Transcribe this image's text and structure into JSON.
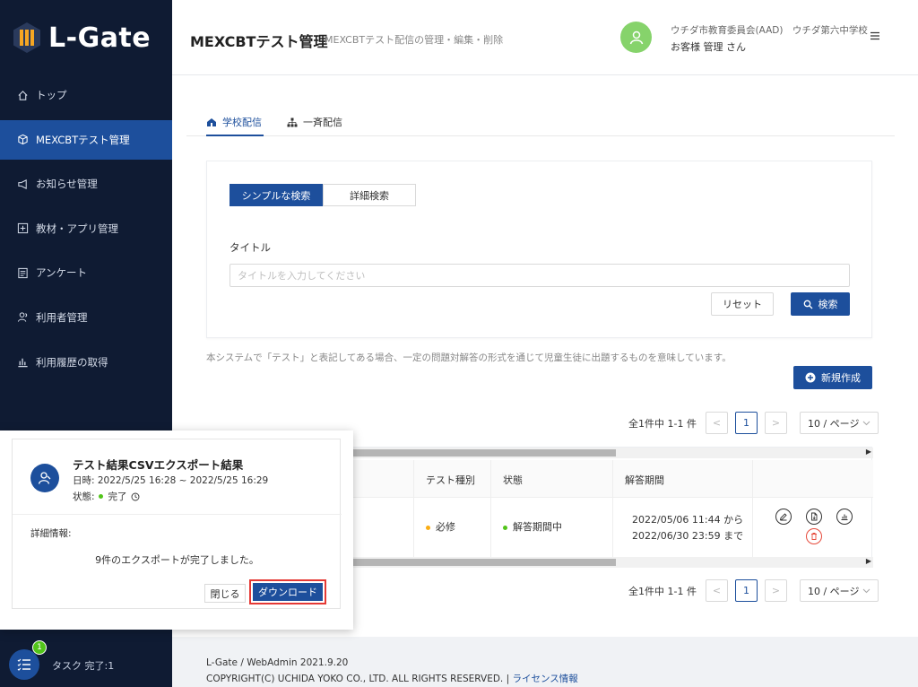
{
  "app": {
    "logo_text": "L-Gate"
  },
  "sidebar": {
    "items": [
      {
        "label": "トップ",
        "icon": "home-icon"
      },
      {
        "label": "MEXCBTテスト管理",
        "icon": "cube-icon",
        "active": true
      },
      {
        "label": "お知らせ管理",
        "icon": "megaphone-icon"
      },
      {
        "label": "教材・アプリ管理",
        "icon": "plus-square-icon"
      },
      {
        "label": "アンケート",
        "icon": "form-icon"
      },
      {
        "label": "利用者管理",
        "icon": "users-icon"
      },
      {
        "label": "利用履歴の取得",
        "icon": "bar-chart-icon"
      }
    ],
    "task": {
      "label": "タスク 完了:1",
      "badge": "1"
    }
  },
  "header": {
    "title": "MEXCBTテスト管理",
    "subtitle": "MEXCBTテスト配信の管理・編集・削除",
    "org": "ウチダ市教育委員会(AAD)　ウチダ第六中学校",
    "user": "お客様 管理 さん"
  },
  "tabs": [
    {
      "label": "学校配信",
      "icon": "school-icon",
      "active": true
    },
    {
      "label": "一斉配信",
      "icon": "sitemap-icon"
    }
  ],
  "search": {
    "mode_simple": "シンプルな検索",
    "mode_detail": "詳細検索",
    "title_label": "タイトル",
    "title_placeholder": "タイトルを入力してください",
    "reset_label": "リセット",
    "search_label": "検索"
  },
  "notice": "本システムで「テスト」と表記してある場合、一定の問題対解答の形式を通じて児童生徒に出題するものを意味しています。",
  "new_button": "新規作成",
  "pagination": {
    "total": "全1件中 1-1 件",
    "prev": "<",
    "current": "1",
    "next": ">",
    "page_size": "10 / ページ"
  },
  "table": {
    "headers": [
      "テスト種別",
      "状態",
      "解答期間"
    ],
    "rows": [
      {
        "type": "必修",
        "status": "解答期間中",
        "period_start": "2022/05/06 11:44 から",
        "period_end": "2022/06/30 23:59 まで"
      }
    ]
  },
  "popup": {
    "title": "テスト結果CSVエクスポート結果",
    "date": "日時: 2022/5/25 16:28 ~ 2022/5/25 16:29",
    "status_label": "状態:",
    "status_value": "完了",
    "detail_label": "詳細情報:",
    "detail_message": "9件のエクスポートが完了しました。",
    "close_label": "閉じる",
    "download_label": "ダウンロード"
  },
  "footer": {
    "version": "L-Gate / WebAdmin 2021.9.20",
    "copyright": "COPYRIGHT(C) UCHIDA YOKO CO., LTD. ALL RIGHTS RESERVED. | ",
    "license_link": "ライセンス情報"
  },
  "colors": {
    "primary": "#1d4f9c",
    "sidebar_bg": "#0f1b33",
    "success": "#52c41a",
    "warning": "#faad14",
    "danger": "#e53935"
  }
}
